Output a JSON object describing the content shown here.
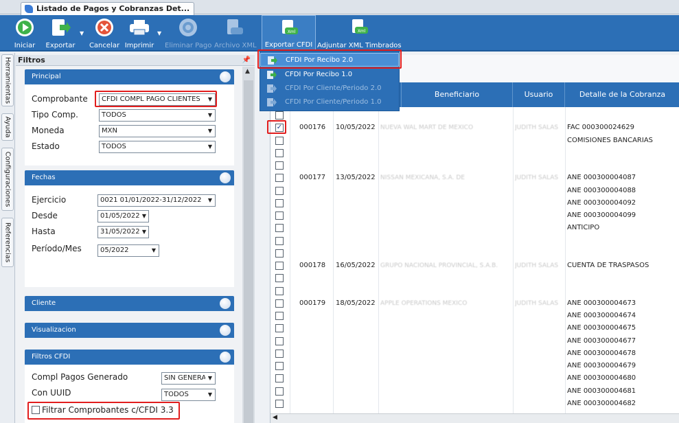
{
  "window": {
    "tab_title": "Listado de Pagos y Cobranzas Det..."
  },
  "toolbar": {
    "buttons": [
      {
        "label": "Iniciar",
        "icon": "play-icon"
      },
      {
        "label": "Exportar",
        "icon": "export-icon"
      },
      {
        "label": "Cancelar",
        "icon": "cancel-icon"
      },
      {
        "label": "Imprimir",
        "icon": "printer-icon"
      },
      {
        "label": "Eliminar Pago",
        "icon": "delete-payment-icon"
      },
      {
        "label": "Archivo XML",
        "icon": "xml-file-icon"
      },
      {
        "label": "Exportar CFDI",
        "icon": "xml-export-icon"
      },
      {
        "label": "Adjuntar XML Timbrados",
        "icon": "xml-attach-icon"
      }
    ]
  },
  "export_menu": {
    "items": [
      {
        "label": "CFDI Por Recibo 2.0",
        "selected": true
      },
      {
        "label": "CFDI Por Recibo 1.0",
        "selected": false
      },
      {
        "label": "CFDI Por Cliente/Periodo 2.0",
        "selected": false
      },
      {
        "label": "CFDI Por Cliente/Periodo 1.0",
        "selected": false
      }
    ]
  },
  "side_tabs": [
    "Herramientas",
    "Ayuda",
    "Configuraciones",
    "Referencias"
  ],
  "filters": {
    "title": "Filtros",
    "principal": {
      "title": "Principal",
      "comprobante_label": "Comprobante",
      "comprobante_value": "CFDI COMPL PAGO CLIENTES",
      "tipo_label": "Tipo Comp.",
      "tipo_value": "TODOS",
      "moneda_label": "Moneda",
      "moneda_value": "MXN",
      "estado_label": "Estado",
      "estado_value": "TODOS"
    },
    "fechas": {
      "title": "Fechas",
      "ejercicio_label": "Ejercicio",
      "ejercicio_value": "0021 01/01/2022-31/12/2022",
      "desde_label": "Desde",
      "desde_value": "01/05/2022",
      "hasta_label": "Hasta",
      "hasta_value": "31/05/2022",
      "periodo_label": "Período/Mes",
      "periodo_value": "05/2022"
    },
    "cliente": {
      "title": "Cliente"
    },
    "visualizacion": {
      "title": "Visualizacion"
    },
    "filtros_cfdi": {
      "title": "Filtros CFDI",
      "compl_label": "Compl Pagos Generado",
      "compl_value": "SIN GENERA",
      "uuid_label": "Con UUID",
      "uuid_value": "TODOS",
      "filtrar_label": "Filtrar Comprobantes c/CFDI  3.3"
    }
  },
  "grid": {
    "columns": [
      "Beneficiario",
      "Usuario",
      "Detalle de la Cobranza"
    ],
    "rows": [
      {
        "checked": false,
        "num": "",
        "fecha": "",
        "beneficiario": "",
        "usuario": "",
        "detalle": ""
      },
      {
        "checked": true,
        "num": "000176",
        "fecha": "10/05/2022",
        "beneficiario": "NUEVA WAL MART DE MEXICO",
        "usuario": "JUDITH SALAS",
        "detalle": "FAC 000300024629"
      },
      {
        "checked": false,
        "num": "",
        "fecha": "",
        "beneficiario": "",
        "usuario": "",
        "detalle": "COMISIONES BANCARIAS"
      },
      {
        "checked": false,
        "num": "",
        "fecha": "",
        "beneficiario": "",
        "usuario": "",
        "detalle": ""
      },
      {
        "checked": false,
        "num": "",
        "fecha": "",
        "beneficiario": "",
        "usuario": "",
        "detalle": ""
      },
      {
        "checked": false,
        "num": "000177",
        "fecha": "13/05/2022",
        "beneficiario": "NISSAN MEXICANA, S.A. DE",
        "usuario": "JUDITH SALAS",
        "detalle": "ANE 000300004087"
      },
      {
        "checked": false,
        "num": "",
        "fecha": "",
        "beneficiario": "",
        "usuario": "",
        "detalle": "ANE 000300004088"
      },
      {
        "checked": false,
        "num": "",
        "fecha": "",
        "beneficiario": "",
        "usuario": "",
        "detalle": "ANE 000300004092"
      },
      {
        "checked": false,
        "num": "",
        "fecha": "",
        "beneficiario": "",
        "usuario": "",
        "detalle": "ANE 000300004099"
      },
      {
        "checked": false,
        "num": "",
        "fecha": "",
        "beneficiario": "",
        "usuario": "",
        "detalle": "ANTICIPO"
      },
      {
        "checked": false,
        "num": "",
        "fecha": "",
        "beneficiario": "",
        "usuario": "",
        "detalle": ""
      },
      {
        "checked": false,
        "num": "",
        "fecha": "",
        "beneficiario": "",
        "usuario": "",
        "detalle": ""
      },
      {
        "checked": false,
        "num": "000178",
        "fecha": "16/05/2022",
        "beneficiario": "GRUPO NACIONAL PROVINCIAL, S.A.B.",
        "usuario": "JUDITH SALAS",
        "detalle": "CUENTA DE TRASPASOS"
      },
      {
        "checked": false,
        "num": "",
        "fecha": "",
        "beneficiario": "",
        "usuario": "",
        "detalle": ""
      },
      {
        "checked": false,
        "num": "",
        "fecha": "",
        "beneficiario": "",
        "usuario": "",
        "detalle": ""
      },
      {
        "checked": false,
        "num": "000179",
        "fecha": "18/05/2022",
        "beneficiario": "APPLE OPERATIONS MEXICO",
        "usuario": "JUDITH SALAS",
        "detalle": "ANE 000300004673"
      },
      {
        "checked": false,
        "num": "",
        "fecha": "",
        "beneficiario": "",
        "usuario": "",
        "detalle": "ANE 000300004674"
      },
      {
        "checked": false,
        "num": "",
        "fecha": "",
        "beneficiario": "",
        "usuario": "",
        "detalle": "ANE 000300004675"
      },
      {
        "checked": false,
        "num": "",
        "fecha": "",
        "beneficiario": "",
        "usuario": "",
        "detalle": "ANE 000300004677"
      },
      {
        "checked": false,
        "num": "",
        "fecha": "",
        "beneficiario": "",
        "usuario": "",
        "detalle": "ANE 000300004678"
      },
      {
        "checked": false,
        "num": "",
        "fecha": "",
        "beneficiario": "",
        "usuario": "",
        "detalle": "ANE 000300004679"
      },
      {
        "checked": false,
        "num": "",
        "fecha": "",
        "beneficiario": "",
        "usuario": "",
        "detalle": "ANE 000300004680"
      },
      {
        "checked": false,
        "num": "",
        "fecha": "",
        "beneficiario": "",
        "usuario": "",
        "detalle": "ANE 000300004681"
      },
      {
        "checked": false,
        "num": "",
        "fecha": "",
        "beneficiario": "",
        "usuario": "",
        "detalle": "ANE 000300004682"
      }
    ]
  },
  "colors": {
    "ribbon": "#2c6fb6",
    "highlight": "#e11d1d",
    "header": "#2c6fb6"
  }
}
